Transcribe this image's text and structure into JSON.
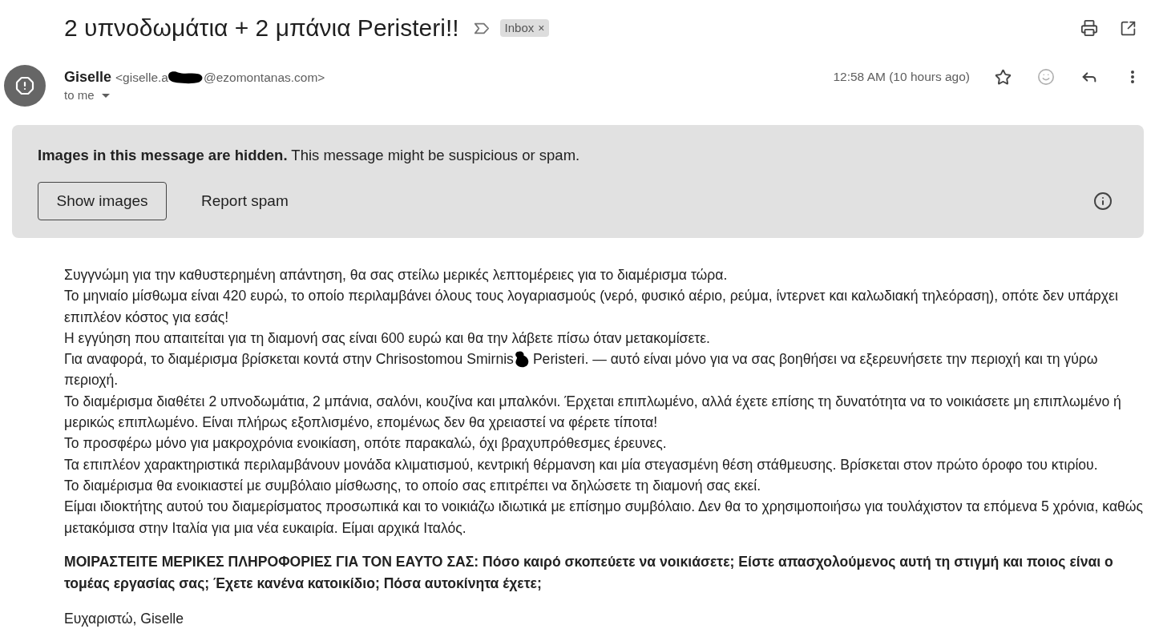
{
  "subject": {
    "title": "2 υπνοδωμάτια + 2 μπάνια Peristeri!!",
    "important": false
  },
  "labels": [
    {
      "name": "Inbox",
      "remove": "×"
    }
  ],
  "sender": {
    "name": "Giselle",
    "email_parts": [
      "<giselle.a",
      "@ezomontanas.com>"
    ],
    "recipient": "to me"
  },
  "message_meta": {
    "time": "12:58 AM (10 hours ago)",
    "starred": false
  },
  "warning": {
    "text": "**Images in this message are hidden.** This message might be suspicious or spam.",
    "buttons": [
      {
        "label": "Show images",
        "kind": "outlined"
      },
      {
        "label": "Report spam",
        "kind": "text"
      }
    ]
  },
  "body": {
    "lines": [
      {
        "segments": [
          "Συγγνώμη για την καθυστερημένη απάντηση, θα σας στείλω μερικές λεπτομέρειες για το διαμέρισμα τώρα."
        ]
      },
      {
        "segments": [
          "Το μηνιαίο μίσθωμα είναι 420 ευρώ, το οποίο περιλαμβάνει όλους τους λογαριασμούς (νερό, φυσικό αέριο, ρεύμα, ίντερνετ και καλωδιακή τηλεόραση), οπότε δεν υπάρχει επιπλέον κόστος για εσάς!"
        ]
      },
      {
        "segments": [
          "Η εγγύηση που απαιτείται για τη διαμονή σας είναι 600 ευρώ και θα την λάβετε πίσω όταν μετακομίσετε."
        ]
      },
      {
        "segments": [
          "Για αναφορά, το διαμέρισμα βρίσκεται κοντά στην Chrisostomou Smirnis",
          "Peristeri. — αυτό είναι μόνο για να σας βοηθήσει να εξερευνήσετε την περιοχή και τη γύρω περιοχή."
        ]
      },
      {
        "segments": [
          "Το διαμέρισμα διαθέτει 2 υπνοδωμάτια, 2 μπάνια, σαλόνι, κουζίνα και μπαλκόνι. Έρχεται επιπλωμένο, αλλά έχετε επίσης τη δυνατότητα να το νοικιάσετε μη επιπλωμένο ή μερικώς επιπλωμένο. Είναι πλήρως εξοπλισμένο, επομένως δεν θα χρειαστεί να φέρετε τίποτα!"
        ]
      },
      {
        "segments": [
          "Το προσφέρω μόνο για μακροχρόνια ενοικίαση, οπότε παρακαλώ, όχι βραχυπρόθεσμες έρευνες."
        ]
      },
      {
        "segments": [
          "Τα επιπλέον χαρακτηριστικά περιλαμβάνουν μονάδα κλιματισμού, κεντρική θέρμανση και μία στεγασμένη θέση στάθμευσης. Βρίσκεται στον πρώτο όροφο του κτιρίου."
        ]
      },
      {
        "segments": [
          "Το διαμέρισμα θα ενοικιαστεί με συμβόλαιο μίσθωσης, το οποίο σας επιτρέπει να δηλώσετε τη διαμονή σας εκεί."
        ]
      },
      {
        "segments": [
          "Είμαι ιδιοκτήτης αυτού του διαμερίσματος προσωπικά και το νοικιάζω ιδιωτικά με επίσημο συμβόλαιο. Δεν θα το χρησιμοποιήσω για τουλάχιστον τα επόμενα 5 χρόνια, καθώς μετακόμισα στην Ιταλία για μια νέα ευκαιρία. Είμαι αρχικά Ιταλός."
        ]
      }
    ],
    "questions": "ΜΟΙΡΑΣΤΕΙΤΕ ΜΕΡΙΚΕΣ ΠΛΗΡΟΦΟΡΙΕΣ ΓΙΑ ΤΟΝ ΕΑΥΤΟ ΣΑΣ: Πόσο καιρό σκοπεύετε να νοικιάσετε; Είστε απασχολούμενος αυτή τη στιγμή και ποιος είναι ο τομέας εργασίας σας; Έχετε κανένα κατοικίδιο; Πόσα αυτοκίνητα έχετε;",
    "signoff": "Ευχαριστώ, Giselle"
  }
}
